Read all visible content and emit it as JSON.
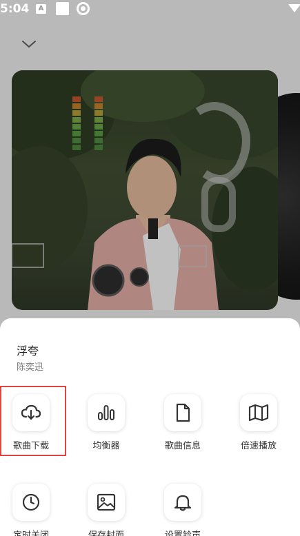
{
  "status_bar": {
    "time": "5:04",
    "badge": "A"
  },
  "player": {
    "collapse_icon": "chevron-down-icon",
    "album_art": "album-cover"
  },
  "song": {
    "title": "浮夸",
    "artist": "陈奕迅"
  },
  "actions": [
    {
      "label": "歌曲下载",
      "icon": "cloud-download-icon",
      "highlighted": true
    },
    {
      "label": "均衡器",
      "icon": "equalizer-icon",
      "highlighted": false
    },
    {
      "label": "歌曲信息",
      "icon": "document-icon",
      "highlighted": false
    },
    {
      "label": "倍速播放",
      "icon": "map-icon",
      "highlighted": false
    },
    {
      "label": "定时关闭",
      "icon": "clock-icon",
      "highlighted": false
    },
    {
      "label": "保存封面",
      "icon": "image-icon",
      "highlighted": false
    },
    {
      "label": "设置铃声",
      "icon": "bell-icon",
      "highlighted": false
    }
  ],
  "colors": {
    "highlight": "#e0443e",
    "sheet": "#ffffff",
    "dim_overlay": "#b9b9b9"
  }
}
